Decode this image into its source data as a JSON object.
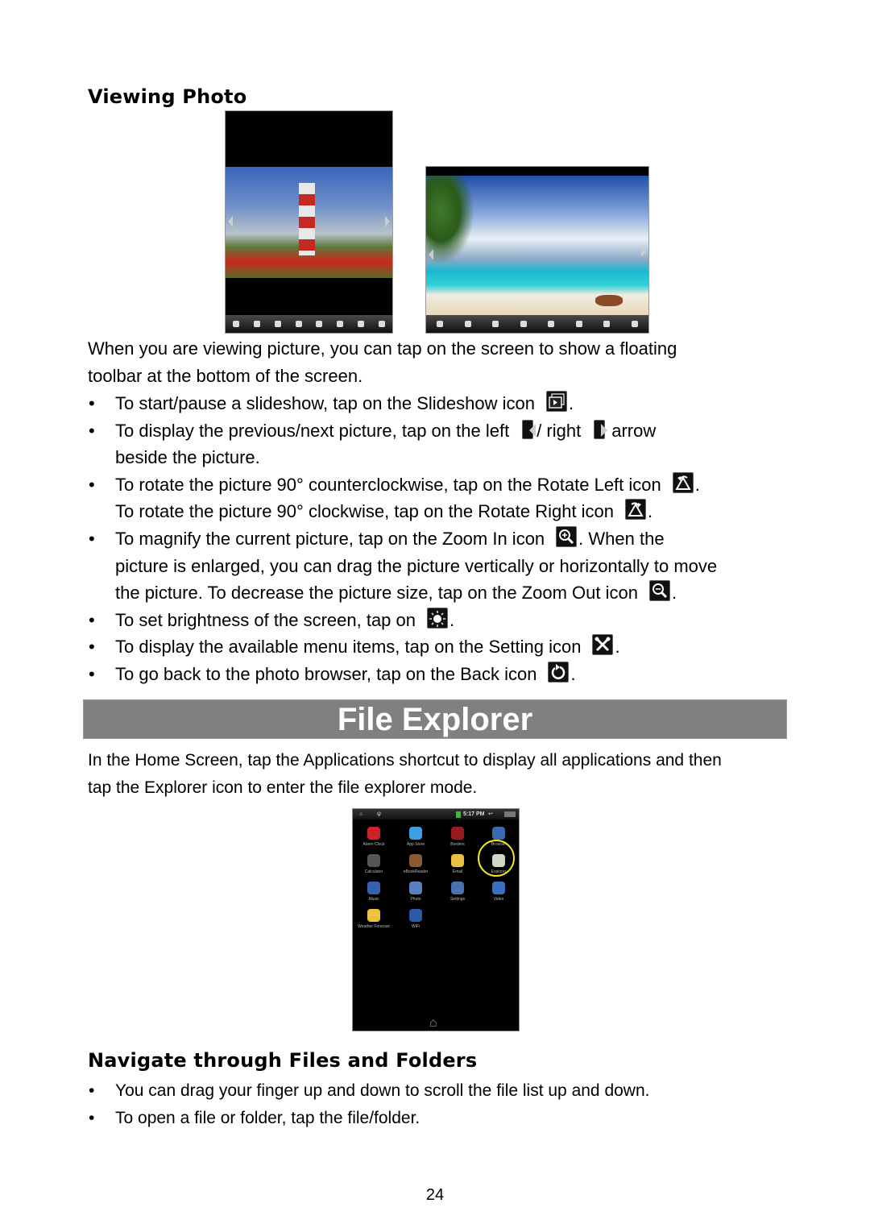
{
  "viewing_photo": {
    "heading": "Viewing Photo",
    "intro": [
      "When you are viewing picture, you can tap on the screen to show a floating",
      "toolbar at the bottom of the screen."
    ],
    "bullets": [
      {
        "lines": [
          {
            "before": "To start/pause a slideshow, tap on the Slideshow icon",
            "icon": "slideshow-icon",
            "after": "."
          }
        ]
      },
      {
        "lines": [
          {
            "before": "To display the previous/next picture, tap on the left",
            "icon": "left-arrow-icon",
            "mid": "/ right",
            "icon2": "right-arrow-icon",
            "after": "arrow"
          },
          {
            "before": "beside the picture."
          }
        ]
      },
      {
        "lines": [
          {
            "before": "To rotate the picture 90° counterclockwise, tap on the Rotate Left icon",
            "icon": "rotate-left-icon",
            "after": "."
          },
          {
            "before": "To rotate the picture 90° clockwise, tap on the Rotate Right icon",
            "icon": "rotate-right-icon",
            "after": "."
          }
        ]
      },
      {
        "lines": [
          {
            "before": "To magnify the current picture, tap on the Zoom In icon",
            "icon": "zoom-in-icon",
            "after": ". When the"
          },
          {
            "before": "picture is enlarged, you can drag the picture vertically or horizontally to move"
          },
          {
            "before": "the picture. To decrease the picture size, tap on the Zoom Out icon",
            "icon": "zoom-out-icon",
            "after": "."
          }
        ]
      },
      {
        "lines": [
          {
            "before": "To set brightness of the screen, tap on",
            "icon": "brightness-icon",
            "after": "."
          }
        ]
      },
      {
        "lines": [
          {
            "before": "To display the available menu items, tap on the Setting icon",
            "icon": "setting-icon",
            "after": "."
          }
        ]
      },
      {
        "lines": [
          {
            "before": "To go back to the photo browser, tap on the Back icon",
            "icon": "back-icon",
            "after": "."
          }
        ]
      }
    ]
  },
  "file_explorer": {
    "banner": "File Explorer",
    "intro": [
      "In the Home Screen, tap the Applications shortcut to display all applications and then",
      "tap the Explorer icon to enter the file explorer mode."
    ],
    "tablet": {
      "time": "5:17 PM",
      "apps": [
        {
          "label": "Alarm Clock",
          "color": "#d0202a"
        },
        {
          "label": "App Store",
          "color": "#3aa0e0"
        },
        {
          "label": "Borders",
          "color": "#9a1a20"
        },
        {
          "label": "Browser",
          "color": "#3a6ab0"
        },
        {
          "label": "Calculator",
          "color": "#555555"
        },
        {
          "label": "eBookReader",
          "color": "#8a5a30"
        },
        {
          "label": "Email",
          "color": "#e8c040"
        },
        {
          "label": "Explorer",
          "color": "#cfd8c8"
        },
        {
          "label": "Music",
          "color": "#3a60b0"
        },
        {
          "label": "Photo",
          "color": "#5a80c0"
        },
        {
          "label": "Settings",
          "color": "#4a70b0"
        },
        {
          "label": "Video",
          "color": "#3a70c0"
        },
        {
          "label": "Weather Forecast",
          "color": "#f0c040"
        },
        {
          "label": "WiFi",
          "color": "#2a5aa8"
        }
      ]
    },
    "subheading": "Navigate through Files and Folders",
    "bullets": [
      "You can drag your finger up and down to scroll the file list up and down.",
      "To open a file or folder, tap the file/folder."
    ]
  },
  "bullet_char": "•",
  "page_number": "24"
}
